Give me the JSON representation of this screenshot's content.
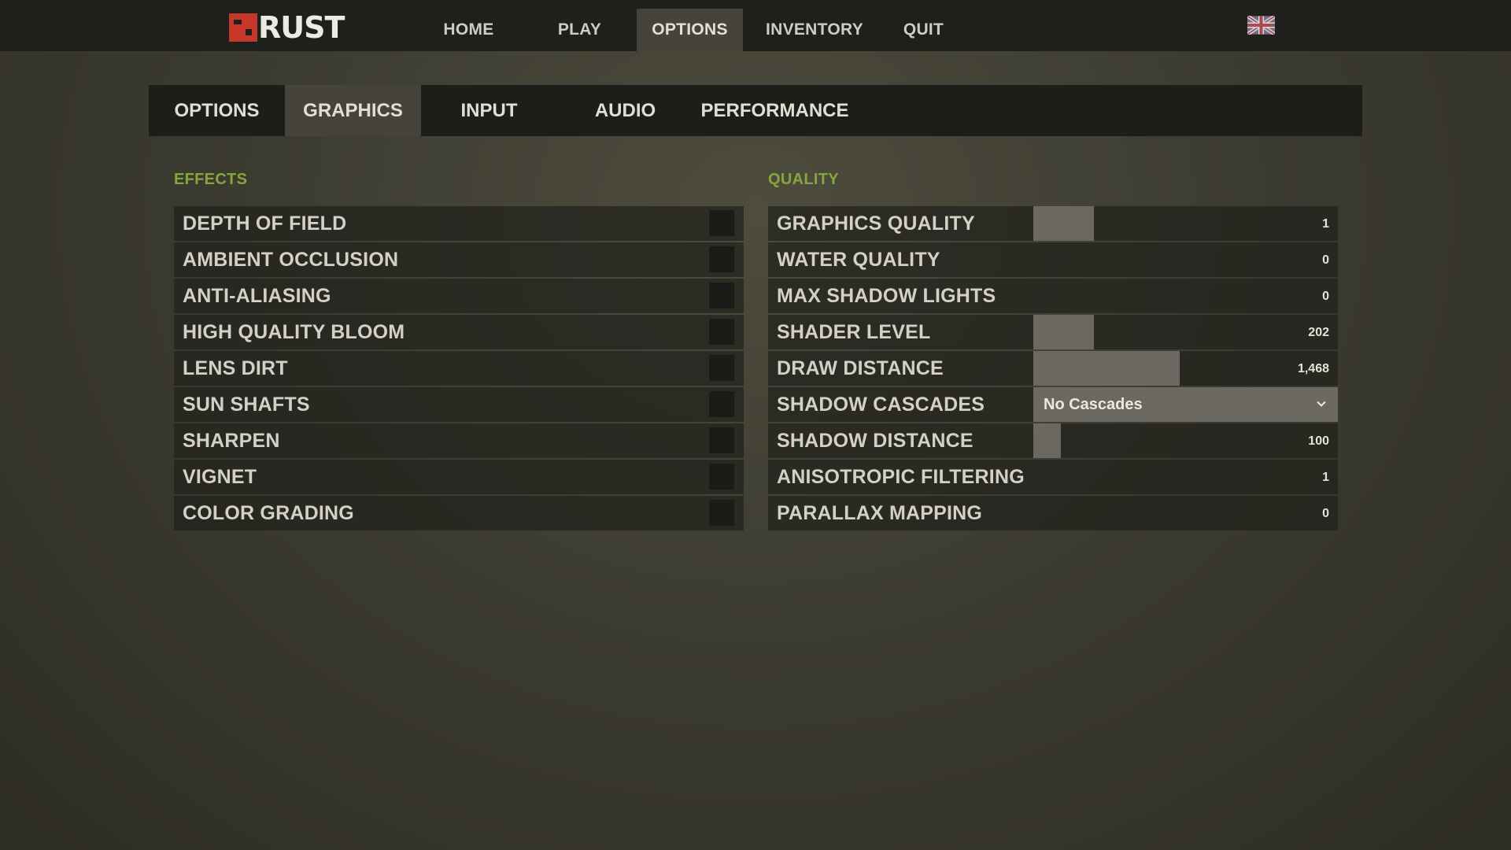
{
  "logo": {
    "text": "RUST"
  },
  "topnav": {
    "items": [
      {
        "label": "HOME"
      },
      {
        "label": "PLAY"
      },
      {
        "label": "OPTIONS"
      },
      {
        "label": "INVENTORY"
      },
      {
        "label": "QUIT"
      }
    ],
    "active": "OPTIONS",
    "language_icon": "uk-flag-icon"
  },
  "tabs": {
    "items": [
      {
        "label": "OPTIONS"
      },
      {
        "label": "GRAPHICS"
      },
      {
        "label": "INPUT"
      },
      {
        "label": "AUDIO"
      },
      {
        "label": "PERFORMANCE"
      }
    ],
    "active": "GRAPHICS"
  },
  "effects": {
    "title": "EFFECTS",
    "items": [
      {
        "label": "DEPTH OF FIELD",
        "checked": false
      },
      {
        "label": "AMBIENT OCCLUSION",
        "checked": false
      },
      {
        "label": "ANTI-ALIASING",
        "checked": false
      },
      {
        "label": "HIGH QUALITY BLOOM",
        "checked": false
      },
      {
        "label": "LENS DIRT",
        "checked": false
      },
      {
        "label": "SUN SHAFTS",
        "checked": false
      },
      {
        "label": "SHARPEN",
        "checked": false
      },
      {
        "label": "VIGNET",
        "checked": false
      },
      {
        "label": "COLOR GRADING",
        "checked": false
      }
    ]
  },
  "quality": {
    "title": "QUALITY",
    "items": [
      {
        "label": "GRAPHICS QUALITY",
        "value": "1",
        "fill": 0.2
      },
      {
        "label": "WATER QUALITY",
        "value": "0",
        "fill": 0
      },
      {
        "label": "MAX SHADOW LIGHTS",
        "value": "0",
        "fill": 0
      },
      {
        "label": "SHADER LEVEL",
        "value": "202",
        "fill": 0.2
      },
      {
        "label": "DRAW DISTANCE",
        "value": "1,468",
        "fill": 0.48
      },
      {
        "label": "SHADOW CASCADES",
        "dropdown": "No Cascades"
      },
      {
        "label": "SHADOW DISTANCE",
        "value": "100",
        "fill": 0.09
      },
      {
        "label": "ANISOTROPIC FILTERING",
        "value": "1",
        "fill": 0
      },
      {
        "label": "PARALLAX MAPPING",
        "value": "0",
        "fill": 0
      }
    ]
  },
  "colors": {
    "accent_green": "#86a63d",
    "brand_red": "#c7382a",
    "active_tab": "#45433a",
    "slider_fill": "#6a6861"
  }
}
